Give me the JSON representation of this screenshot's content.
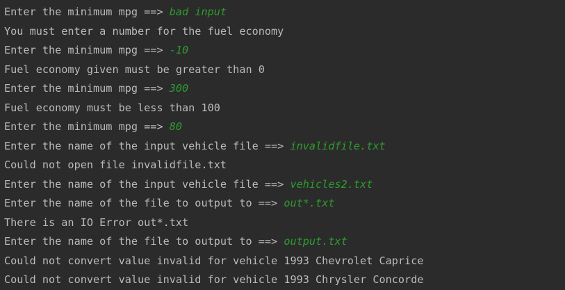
{
  "colors": {
    "background": "#2b2b2b",
    "output_text": "#bbbbbb",
    "user_input": "#2e9b2e"
  },
  "console": {
    "lines": [
      {
        "text": "Enter the minimum mpg ==> ",
        "input": "bad input"
      },
      {
        "text": "You must enter a number for the fuel economy",
        "input": ""
      },
      {
        "text": "Enter the minimum mpg ==> ",
        "input": "-10"
      },
      {
        "text": "Fuel economy given must be greater than 0",
        "input": ""
      },
      {
        "text": "Enter the minimum mpg ==> ",
        "input": "300"
      },
      {
        "text": "Fuel economy must be less than 100",
        "input": ""
      },
      {
        "text": "Enter the minimum mpg ==> ",
        "input": "80"
      },
      {
        "text": "Enter the name of the input vehicle file ==> ",
        "input": "invalidfile.txt"
      },
      {
        "text": "Could not open file invalidfile.txt",
        "input": ""
      },
      {
        "text": "Enter the name of the input vehicle file ==> ",
        "input": "vehicles2.txt"
      },
      {
        "text": "Enter the name of the file to output to ==> ",
        "input": "out*.txt"
      },
      {
        "text": "There is an IO Error out*.txt",
        "input": ""
      },
      {
        "text": "Enter the name of the file to output to ==> ",
        "input": "output.txt"
      },
      {
        "text": "Could not convert value invalid for vehicle 1993 Chevrolet Caprice",
        "input": ""
      },
      {
        "text": "Could not convert value invalid for vehicle 1993 Chrysler Concorde",
        "input": ""
      }
    ]
  }
}
